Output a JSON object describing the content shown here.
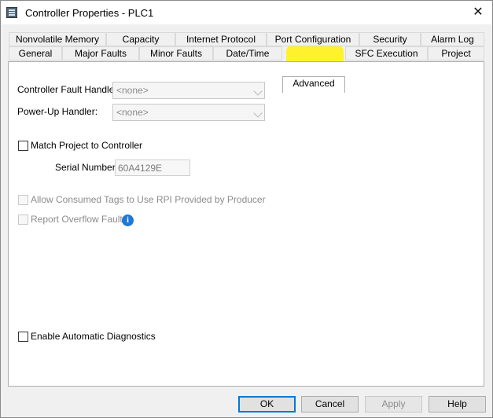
{
  "window": {
    "title": "Controller Properties - PLC1",
    "close_symbol": "✕"
  },
  "tabs_row1": [
    "Nonvolatile Memory",
    "Capacity",
    "Internet Protocol",
    "Port Configuration",
    "Security",
    "Alarm Log"
  ],
  "tabs_row2": [
    "General",
    "Major Faults",
    "Minor Faults",
    "Date/Time",
    "Advanced",
    "SFC Execution",
    "Project"
  ],
  "active_tab": "Advanced",
  "fields": {
    "controller_fault_handler": {
      "label": "Controller Fault Handler:",
      "value": "<none>"
    },
    "power_up_handler": {
      "label": "Power-Up Handler:",
      "value": "<none>"
    },
    "match_project": {
      "label": "Match Project to Controller",
      "checked": false
    },
    "serial_number": {
      "label": "Serial Number:",
      "value": "60A4129E"
    },
    "allow_consumed_tags": {
      "label": "Allow Consumed Tags to Use RPI Provided by Producer",
      "checked": false
    },
    "report_overflow": {
      "label": "Report Overflow Faults",
      "checked": false
    },
    "enable_diagnostics": {
      "label": "Enable Automatic Diagnostics",
      "checked": false
    }
  },
  "buttons": {
    "ok": "OK",
    "cancel": "Cancel",
    "apply": "Apply",
    "help": "Help"
  },
  "icons": {
    "app": "controller-icon",
    "info": "info-icon"
  },
  "colors": {
    "highlight": "#fff200",
    "accent": "#0078d7"
  }
}
